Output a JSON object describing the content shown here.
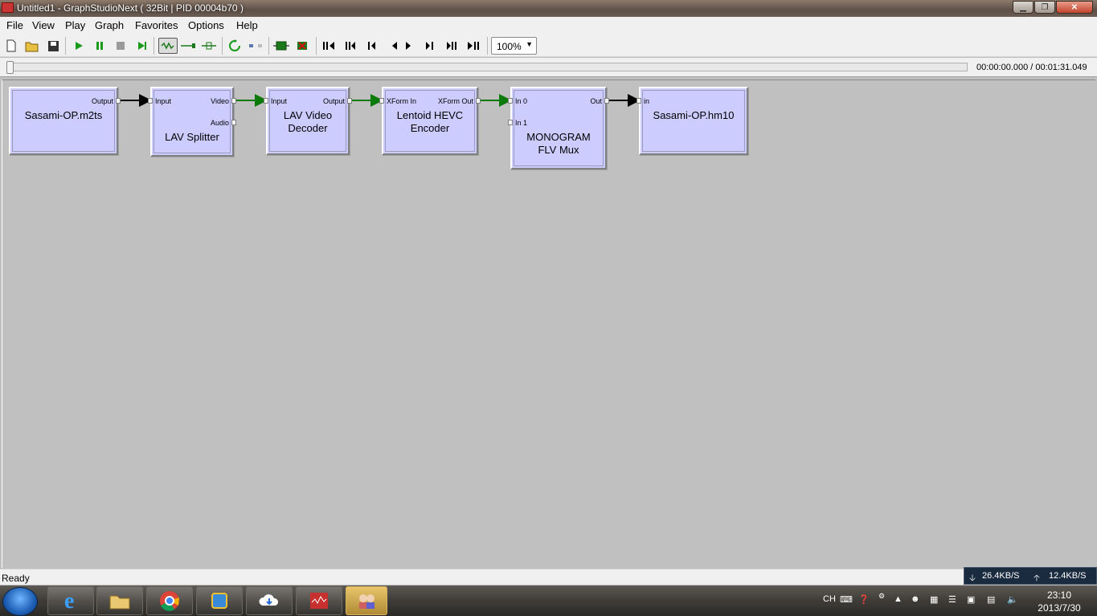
{
  "window": {
    "title": "Untitled1 - GraphStudioNext ( 32Bit | PID 00004b70 )",
    "min_label": "▁",
    "max_label": "❐",
    "close_label": "✕"
  },
  "menu": [
    "File",
    "View",
    "Play",
    "Graph",
    "Favorites",
    "Options",
    "Help"
  ],
  "toolbar": {
    "zoom_value": "100%"
  },
  "seek": {
    "time_display": "00:00:00.000 / 00:01:31.049",
    "position_fraction": 0
  },
  "filters": [
    {
      "name": "Sasami-OP.m2ts",
      "pins_out": [
        "Output"
      ],
      "pins_in": []
    },
    {
      "name": "LAV Splitter",
      "pins_in": [
        "Input"
      ],
      "pins_out": [
        "Video",
        "Audio"
      ]
    },
    {
      "name": "LAV Video Decoder",
      "name_lines": [
        "LAV Video",
        "Decoder"
      ],
      "pins_in": [
        "Input"
      ],
      "pins_out": [
        "Output"
      ]
    },
    {
      "name": "Lentoid HEVC Encoder",
      "name_lines": [
        "Lentoid HEVC",
        "Encoder"
      ],
      "pins_in": [
        "XForm In"
      ],
      "pins_out": [
        "XForm Out"
      ]
    },
    {
      "name": "MONOGRAM FLV Mux",
      "name_lines": [
        "MONOGRAM",
        "FLV Mux"
      ],
      "pins_in": [
        "In 0",
        "In 1"
      ],
      "pins_out": [
        "Out"
      ]
    },
    {
      "name": "Sasami-OP.hm10",
      "pins_in": [
        "in"
      ],
      "pins_out": []
    }
  ],
  "status": {
    "text": "Ready"
  },
  "network": {
    "down": "26.4KB/S",
    "up": "12.4KB/S"
  },
  "tray": {
    "lang": "CH"
  },
  "clock": {
    "time": "23:10",
    "date": "2013/7/30"
  }
}
